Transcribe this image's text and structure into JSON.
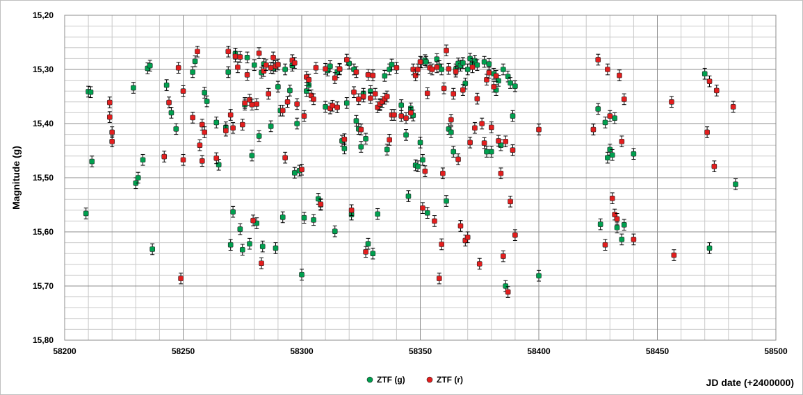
{
  "chart_data": {
    "type": "scatter",
    "xlabel": "JD date (+2400000)",
    "ylabel": "Magnitude (g)",
    "xlim": [
      58200,
      58500
    ],
    "ylim": [
      15.2,
      15.8
    ],
    "y_inverted": true,
    "x_ticks": [
      "58200",
      "58250",
      "58300",
      "58350",
      "58400",
      "58450",
      "58500"
    ],
    "x_tick_values": [
      58200,
      58250,
      58300,
      58350,
      58400,
      58450,
      58500
    ],
    "y_ticks": [
      "15,20",
      "15,30",
      "15,40",
      "15,50",
      "15,60",
      "15,70",
      "15,80"
    ],
    "y_tick_values": [
      15.2,
      15.3,
      15.4,
      15.5,
      15.6,
      15.7,
      15.8
    ],
    "grid": true,
    "error_bar": 0.01,
    "legend_position": "bottom-center",
    "series": [
      {
        "name": "ZTF (g)",
        "color": "#00A04F",
        "points": [
          [
            58209,
            15.566
          ],
          [
            58210,
            15.341
          ],
          [
            58211,
            15.342
          ],
          [
            58211.5,
            15.47
          ],
          [
            58229,
            15.334
          ],
          [
            58230,
            15.51
          ],
          [
            58231,
            15.5
          ],
          [
            58233,
            15.467
          ],
          [
            58235,
            15.298
          ],
          [
            58236,
            15.293
          ],
          [
            58237,
            15.632
          ],
          [
            58243,
            15.329
          ],
          [
            58245,
            15.38
          ],
          [
            58247,
            15.41
          ],
          [
            58254,
            15.305
          ],
          [
            58255,
            15.285
          ],
          [
            58259,
            15.343
          ],
          [
            58260,
            15.359
          ],
          [
            58264,
            15.398
          ],
          [
            58265,
            15.476
          ],
          [
            58268,
            15.407
          ],
          [
            58269,
            15.305
          ],
          [
            58270,
            15.624
          ],
          [
            58271,
            15.563
          ],
          [
            58272,
            15.271
          ],
          [
            58274,
            15.595
          ],
          [
            58275,
            15.633
          ],
          [
            58276,
            15.365
          ],
          [
            58277,
            15.278
          ],
          [
            58278,
            15.622
          ],
          [
            58279,
            15.459
          ],
          [
            58280,
            15.292
          ],
          [
            58281,
            15.584
          ],
          [
            58282,
            15.423
          ],
          [
            58283,
            15.306
          ],
          [
            58283.5,
            15.627
          ],
          [
            58284,
            15.29
          ],
          [
            58287,
            15.405
          ],
          [
            58288,
            15.298
          ],
          [
            58289,
            15.63
          ],
          [
            58290,
            15.332
          ],
          [
            58291,
            15.376
          ],
          [
            58292,
            15.573
          ],
          [
            58293,
            15.3
          ],
          [
            58295,
            15.339
          ],
          [
            58296,
            15.293
          ],
          [
            58297,
            15.491
          ],
          [
            58298,
            15.4
          ],
          [
            58299,
            15.487
          ],
          [
            58300,
            15.679
          ],
          [
            58301,
            15.574
          ],
          [
            58302,
            15.34
          ],
          [
            58303,
            15.329
          ],
          [
            58305,
            15.578
          ],
          [
            58307,
            15.539
          ],
          [
            58308,
            15.55
          ],
          [
            58310,
            15.369
          ],
          [
            58311,
            15.302
          ],
          [
            58312,
            15.294
          ],
          [
            58314,
            15.599
          ],
          [
            58315,
            15.305
          ],
          [
            58316,
            15.3
          ],
          [
            58317,
            15.432
          ],
          [
            58318,
            15.446
          ],
          [
            58319,
            15.362
          ],
          [
            58320,
            15.289
          ],
          [
            58321,
            15.568
          ],
          [
            58322,
            15.3
          ],
          [
            58323,
            15.395
          ],
          [
            58324,
            15.41
          ],
          [
            58325,
            15.443
          ],
          [
            58326,
            15.345
          ],
          [
            58327,
            15.428
          ],
          [
            58328,
            15.622
          ],
          [
            58329,
            15.34
          ],
          [
            58330,
            15.64
          ],
          [
            58332,
            15.567
          ],
          [
            58333,
            15.366
          ],
          [
            58335,
            15.312
          ],
          [
            58336,
            15.448
          ],
          [
            58337,
            15.3
          ],
          [
            58338,
            15.291
          ],
          [
            58342,
            15.366
          ],
          [
            58344,
            15.421
          ],
          [
            58345,
            15.534
          ],
          [
            58346,
            15.372
          ],
          [
            58347,
            15.385
          ],
          [
            58348,
            15.477
          ],
          [
            58349,
            15.479
          ],
          [
            58350,
            15.435
          ],
          [
            58350.5,
            15.287
          ],
          [
            58351,
            15.467
          ],
          [
            58352,
            15.283
          ],
          [
            58352.5,
            15.286
          ],
          [
            58353,
            15.565
          ],
          [
            58357,
            15.281
          ],
          [
            58358,
            15.294
          ],
          [
            58359,
            15.3
          ],
          [
            58361,
            15.543
          ],
          [
            58362,
            15.41
          ],
          [
            58363,
            15.416
          ],
          [
            58364,
            15.452
          ],
          [
            58365,
            15.3
          ],
          [
            58366,
            15.289
          ],
          [
            58367,
            15.293
          ],
          [
            58368,
            15.288
          ],
          [
            58369,
            15.326
          ],
          [
            58370,
            15.3
          ],
          [
            58371,
            15.28
          ],
          [
            58372,
            15.29
          ],
          [
            58373,
            15.284
          ],
          [
            58374,
            15.292
          ],
          [
            58377,
            15.286
          ],
          [
            58378,
            15.452
          ],
          [
            58379,
            15.29
          ],
          [
            58380,
            15.452
          ],
          [
            58381,
            15.308
          ],
          [
            58382,
            15.338
          ],
          [
            58383,
            15.321
          ],
          [
            58384,
            15.44
          ],
          [
            58385,
            15.3
          ],
          [
            58386,
            15.7
          ],
          [
            58387,
            15.313
          ],
          [
            58388,
            15.325
          ],
          [
            58389,
            15.386
          ],
          [
            58390,
            15.331
          ],
          [
            58400,
            15.681
          ],
          [
            58425,
            15.373
          ],
          [
            58426,
            15.586
          ],
          [
            58428,
            15.398
          ],
          [
            58429,
            15.463
          ],
          [
            58430,
            15.448
          ],
          [
            58431,
            15.458
          ],
          [
            58432,
            15.39
          ],
          [
            58433,
            15.592
          ],
          [
            58435,
            15.614
          ],
          [
            58436,
            15.587
          ],
          [
            58440,
            15.456
          ],
          [
            58470,
            15.308
          ],
          [
            58472,
            15.63
          ],
          [
            58483,
            15.512
          ]
        ]
      },
      {
        "name": "ZTF (r)",
        "color": "#E31E1E",
        "points": [
          [
            58219,
            15.361
          ],
          [
            58219,
            15.388
          ],
          [
            58220,
            15.416
          ],
          [
            58220,
            15.433
          ],
          [
            58242,
            15.461
          ],
          [
            58244,
            15.361
          ],
          [
            58248,
            15.297
          ],
          [
            58249,
            15.686
          ],
          [
            58250,
            15.34
          ],
          [
            58250,
            15.467
          ],
          [
            58254,
            15.389
          ],
          [
            58256,
            15.267
          ],
          [
            58257,
            15.44
          ],
          [
            58258,
            15.402
          ],
          [
            58258,
            15.469
          ],
          [
            58259,
            15.416
          ],
          [
            58264,
            15.464
          ],
          [
            58268,
            15.413
          ],
          [
            58269,
            15.267
          ],
          [
            58270,
            15.384
          ],
          [
            58271,
            15.408
          ],
          [
            58272,
            15.276
          ],
          [
            58273,
            15.296
          ],
          [
            58274,
            15.277
          ],
          [
            58275,
            15.402
          ],
          [
            58276,
            15.362
          ],
          [
            58277,
            15.31
          ],
          [
            58278,
            15.356
          ],
          [
            58279,
            15.365
          ],
          [
            58279.5,
            15.579
          ],
          [
            58281,
            15.364
          ],
          [
            58282,
            15.27
          ],
          [
            58283,
            15.658
          ],
          [
            58284,
            15.303
          ],
          [
            58285,
            15.292
          ],
          [
            58286,
            15.345
          ],
          [
            58287,
            15.297
          ],
          [
            58288,
            15.278
          ],
          [
            58289,
            15.294
          ],
          [
            58290,
            15.291
          ],
          [
            58292,
            15.376
          ],
          [
            58293,
            15.463
          ],
          [
            58294,
            15.36
          ],
          [
            58296,
            15.283
          ],
          [
            58297,
            15.288
          ],
          [
            58298,
            15.364
          ],
          [
            58300,
            15.485
          ],
          [
            58301,
            15.386
          ],
          [
            58302,
            15.314
          ],
          [
            58303,
            15.319
          ],
          [
            58304,
            15.348
          ],
          [
            58305,
            15.355
          ],
          [
            58306,
            15.297
          ],
          [
            58308,
            15.549
          ],
          [
            58310,
            15.299
          ],
          [
            58312,
            15.372
          ],
          [
            58313,
            15.367
          ],
          [
            58314,
            15.316
          ],
          [
            58315,
            15.37
          ],
          [
            58316,
            15.299
          ],
          [
            58318,
            15.429
          ],
          [
            58319,
            15.282
          ],
          [
            58321,
            15.56
          ],
          [
            58322,
            15.342
          ],
          [
            58323,
            15.305
          ],
          [
            58324,
            15.355
          ],
          [
            58325,
            15.411
          ],
          [
            58326,
            15.35
          ],
          [
            58327,
            15.637
          ],
          [
            58328,
            15.31
          ],
          [
            58329,
            15.353
          ],
          [
            58330,
            15.311
          ],
          [
            58331,
            15.345
          ],
          [
            58332,
            15.37
          ],
          [
            58333,
            15.364
          ],
          [
            58334,
            15.36
          ],
          [
            58335,
            15.354
          ],
          [
            58336,
            15.35
          ],
          [
            58337,
            15.43
          ],
          [
            58338,
            15.384
          ],
          [
            58339,
            15.384
          ],
          [
            58340,
            15.297
          ],
          [
            58342,
            15.386
          ],
          [
            58344,
            15.39
          ],
          [
            58346,
            15.38
          ],
          [
            58347,
            15.3
          ],
          [
            58348,
            15.311
          ],
          [
            58349,
            15.3
          ],
          [
            58350,
            15.286
          ],
          [
            58351,
            15.556
          ],
          [
            58352,
            15.488
          ],
          [
            58353,
            15.344
          ],
          [
            58354,
            15.297
          ],
          [
            58355,
            15.3
          ],
          [
            58356,
            15.58
          ],
          [
            58357,
            15.296
          ],
          [
            58358,
            15.686
          ],
          [
            58359,
            15.623
          ],
          [
            58359.5,
            15.492
          ],
          [
            58360,
            15.335
          ],
          [
            58361,
            15.265
          ],
          [
            58362,
            15.299
          ],
          [
            58363,
            15.393
          ],
          [
            58364,
            15.345
          ],
          [
            58365,
            15.304
          ],
          [
            58366,
            15.466
          ],
          [
            58367,
            15.589
          ],
          [
            58368,
            15.338
          ],
          [
            58369,
            15.616
          ],
          [
            58370,
            15.61
          ],
          [
            58371,
            15.435
          ],
          [
            58372,
            15.296
          ],
          [
            58373,
            15.408
          ],
          [
            58374,
            15.354
          ],
          [
            58375,
            15.659
          ],
          [
            58376,
            15.4
          ],
          [
            58377,
            15.436
          ],
          [
            58378,
            15.319
          ],
          [
            58379,
            15.306
          ],
          [
            58380,
            15.407
          ],
          [
            58381,
            15.332
          ],
          [
            58382,
            15.312
          ],
          [
            58383,
            15.432
          ],
          [
            58384,
            15.492
          ],
          [
            58385,
            15.645
          ],
          [
            58386,
            15.433
          ],
          [
            58387,
            15.711
          ],
          [
            58388,
            15.544
          ],
          [
            58389,
            15.449
          ],
          [
            58390,
            15.606
          ],
          [
            58400,
            15.411
          ],
          [
            58423,
            15.411
          ],
          [
            58425,
            15.282
          ],
          [
            58428,
            15.624
          ],
          [
            58429,
            15.3
          ],
          [
            58430,
            15.386
          ],
          [
            58431,
            15.538
          ],
          [
            58432,
            15.568
          ],
          [
            58433,
            15.576
          ],
          [
            58434,
            15.311
          ],
          [
            58435,
            15.433
          ],
          [
            58436,
            15.355
          ],
          [
            58440,
            15.614
          ],
          [
            58456,
            15.36
          ],
          [
            58457,
            15.643
          ],
          [
            58471,
            15.416
          ],
          [
            58472,
            15.322
          ],
          [
            58474,
            15.479
          ],
          [
            58475,
            15.339
          ],
          [
            58482,
            15.369
          ]
        ]
      }
    ]
  }
}
